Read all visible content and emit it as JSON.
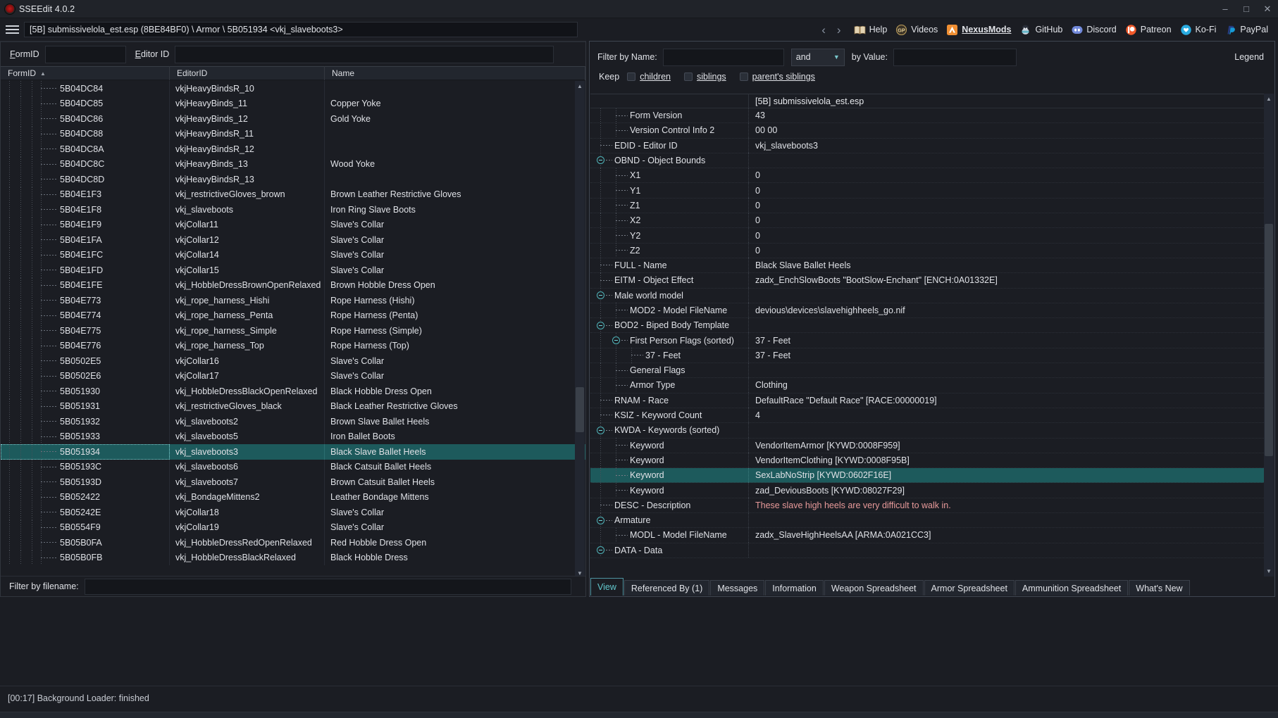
{
  "window": {
    "title": "SSEEdit 4.0.2",
    "app_icon": "sseedit-icon",
    "minimize": "–",
    "maximize": "□",
    "close": "✕"
  },
  "navbar": {
    "menu_icon": "hamburger-icon",
    "path": "[5B] submissivelola_est.esp (8BE84BF0) \\ Armor \\ 5B051934 <vkj_slaveboots3>",
    "back": "‹",
    "forward": "›",
    "links": [
      {
        "label": "Help",
        "icon": "book-icon",
        "active": false
      },
      {
        "label": "Videos",
        "icon": "gamerpoets-icon",
        "active": false
      },
      {
        "label": "NexusMods",
        "icon": "nexusmods-icon",
        "active": true
      },
      {
        "label": "GitHub",
        "icon": "github-icon",
        "active": false
      },
      {
        "label": "Discord",
        "icon": "discord-icon",
        "active": false
      },
      {
        "label": "Patreon",
        "icon": "patreon-icon",
        "active": false
      },
      {
        "label": "Ko-Fi",
        "icon": "kofi-icon",
        "active": false
      },
      {
        "label": "PayPal",
        "icon": "paypal-icon",
        "active": false
      }
    ]
  },
  "left_pane": {
    "filter": {
      "formid_label": "FormID",
      "formid_value": "",
      "editorid_label": "Editor ID",
      "editorid_value": ""
    },
    "columns": [
      "FormID",
      "EditorID",
      "Name"
    ],
    "sort_column": "FormID",
    "sort_direction": "asc",
    "rows": [
      {
        "formid": "5B04DC84",
        "editorid": "vkjHeavyBindsR_10",
        "name": ""
      },
      {
        "formid": "5B04DC85",
        "editorid": "vkjHeavyBinds_11",
        "name": "Copper Yoke"
      },
      {
        "formid": "5B04DC86",
        "editorid": "vkjHeavyBinds_12",
        "name": "Gold Yoke"
      },
      {
        "formid": "5B04DC88",
        "editorid": "vkjHeavyBindsR_11",
        "name": ""
      },
      {
        "formid": "5B04DC8A",
        "editorid": "vkjHeavyBindsR_12",
        "name": ""
      },
      {
        "formid": "5B04DC8C",
        "editorid": "vkjHeavyBinds_13",
        "name": "Wood Yoke"
      },
      {
        "formid": "5B04DC8D",
        "editorid": "vkjHeavyBindsR_13",
        "name": ""
      },
      {
        "formid": "5B04E1F3",
        "editorid": "vkj_restrictiveGloves_brown",
        "name": "Brown Leather Restrictive Gloves"
      },
      {
        "formid": "5B04E1F8",
        "editorid": "vkj_slaveboots",
        "name": "Iron Ring Slave Boots"
      },
      {
        "formid": "5B04E1F9",
        "editorid": "vkjCollar11",
        "name": "Slave's Collar"
      },
      {
        "formid": "5B04E1FA",
        "editorid": "vkjCollar12",
        "name": "Slave's Collar"
      },
      {
        "formid": "5B04E1FC",
        "editorid": "vkjCollar14",
        "name": "Slave's Collar"
      },
      {
        "formid": "5B04E1FD",
        "editorid": "vkjCollar15",
        "name": "Slave's Collar"
      },
      {
        "formid": "5B04E1FE",
        "editorid": "vkj_HobbleDressBrownOpenRelaxed",
        "name": "Brown Hobble Dress Open"
      },
      {
        "formid": "5B04E773",
        "editorid": "vkj_rope_harness_Hishi",
        "name": "Rope Harness (Hishi)"
      },
      {
        "formid": "5B04E774",
        "editorid": "vkj_rope_harness_Penta",
        "name": "Rope Harness (Penta)"
      },
      {
        "formid": "5B04E775",
        "editorid": "vkj_rope_harness_Simple",
        "name": "Rope Harness (Simple)"
      },
      {
        "formid": "5B04E776",
        "editorid": "vkj_rope_harness_Top",
        "name": "Rope Harness (Top)"
      },
      {
        "formid": "5B0502E5",
        "editorid": "vkjCollar16",
        "name": "Slave's Collar"
      },
      {
        "formid": "5B0502E6",
        "editorid": "vkjCollar17",
        "name": "Slave's Collar"
      },
      {
        "formid": "5B051930",
        "editorid": "vkj_HobbleDressBlackOpenRelaxed",
        "name": "Black Hobble Dress Open"
      },
      {
        "formid": "5B051931",
        "editorid": "vkj_restrictiveGloves_black",
        "name": "Black Leather Restrictive Gloves"
      },
      {
        "formid": "5B051932",
        "editorid": "vkj_slaveboots2",
        "name": "Brown Slave Ballet Heels"
      },
      {
        "formid": "5B051933",
        "editorid": "vkj_slaveboots5",
        "name": "Iron Ballet Boots"
      },
      {
        "formid": "5B051934",
        "editorid": "vkj_slaveboots3",
        "name": "Black Slave Ballet Heels",
        "selected": true
      },
      {
        "formid": "5B05193C",
        "editorid": "vkj_slaveboots6",
        "name": "Black Catsuit Ballet Heels"
      },
      {
        "formid": "5B05193D",
        "editorid": "vkj_slaveboots7",
        "name": "Brown Catsuit Ballet Heels"
      },
      {
        "formid": "5B052422",
        "editorid": "vkj_BondageMittens2",
        "name": "Leather Bondage Mittens"
      },
      {
        "formid": "5B05242E",
        "editorid": "vkjCollar18",
        "name": "Slave's Collar"
      },
      {
        "formid": "5B0554F9",
        "editorid": "vkjCollar19",
        "name": "Slave's Collar"
      },
      {
        "formid": "5B05B0FA",
        "editorid": "vkj_HobbleDressRedOpenRelaxed",
        "name": "Red Hobble Dress Open"
      },
      {
        "formid": "5B05B0FB",
        "editorid": "vkj_HobbleDressBlackRelaxed",
        "name": "Black Hobble Dress"
      }
    ],
    "scroll_up_icon": "chevron-up-icon",
    "scroll_down_icon": "chevron-down-icon",
    "bottom_filter_label": "Filter by filename:",
    "bottom_filter_value": ""
  },
  "right_pane": {
    "filter": {
      "name_label": "Filter by Name:",
      "name_value": "",
      "operator": "and",
      "operator_chevron": "chevron-down-icon",
      "value_label": "by Value:",
      "value_value": "",
      "legend": "Legend",
      "keep_label": "Keep",
      "keep_options": [
        {
          "label": "children",
          "checked": false
        },
        {
          "label": "siblings",
          "checked": false
        },
        {
          "label": "parent's siblings",
          "checked": false
        }
      ]
    },
    "column_header": "[5B] submissivelola_est.esp",
    "rows": [
      {
        "key": "Form Version",
        "value": "43",
        "indent": 2,
        "expander": false
      },
      {
        "key": "Version Control Info 2",
        "value": "00 00",
        "indent": 2,
        "expander": false
      },
      {
        "key": "EDID - Editor ID",
        "value": "vkj_slaveboots3",
        "indent": 1,
        "expander": false
      },
      {
        "key": "OBND - Object Bounds",
        "value": "",
        "indent": 1,
        "expander": true
      },
      {
        "key": "X1",
        "value": "0",
        "indent": 2,
        "expander": false
      },
      {
        "key": "Y1",
        "value": "0",
        "indent": 2,
        "expander": false
      },
      {
        "key": "Z1",
        "value": "0",
        "indent": 2,
        "expander": false
      },
      {
        "key": "X2",
        "value": "0",
        "indent": 2,
        "expander": false
      },
      {
        "key": "Y2",
        "value": "0",
        "indent": 2,
        "expander": false
      },
      {
        "key": "Z2",
        "value": "0",
        "indent": 2,
        "expander": false
      },
      {
        "key": "FULL - Name",
        "value": "Black Slave Ballet Heels",
        "indent": 1,
        "expander": false
      },
      {
        "key": "EITM - Object Effect",
        "value": "zadx_EnchSlowBoots \"BootSlow-Enchant\" [ENCH:0A01332E]",
        "indent": 1,
        "expander": false
      },
      {
        "key": "Male world model",
        "value": "",
        "indent": 1,
        "expander": true
      },
      {
        "key": "MOD2 - Model FileName",
        "value": "devious\\devices\\slavehighheels_go.nif",
        "indent": 2,
        "expander": false
      },
      {
        "key": "BOD2 - Biped Body Template",
        "value": "",
        "indent": 1,
        "expander": true
      },
      {
        "key": "First Person Flags (sorted)",
        "value": "37 - Feet",
        "indent": 2,
        "expander": true
      },
      {
        "key": "37 - Feet",
        "value": "37 - Feet",
        "indent": 3,
        "expander": false
      },
      {
        "key": "General Flags",
        "value": "",
        "indent": 2,
        "expander": false
      },
      {
        "key": "Armor Type",
        "value": "Clothing",
        "indent": 2,
        "expander": false
      },
      {
        "key": "RNAM - Race",
        "value": "DefaultRace \"Default Race\" [RACE:00000019]",
        "indent": 1,
        "expander": false
      },
      {
        "key": "KSIZ - Keyword Count",
        "value": "4",
        "indent": 1,
        "expander": false
      },
      {
        "key": "KWDA - Keywords (sorted)",
        "value": "",
        "indent": 1,
        "expander": true
      },
      {
        "key": "Keyword",
        "value": "VendorItemArmor [KYWD:0008F959]",
        "indent": 2,
        "expander": false
      },
      {
        "key": "Keyword",
        "value": "VendorItemClothing [KYWD:0008F95B]",
        "indent": 2,
        "expander": false
      },
      {
        "key": "Keyword",
        "value": "SexLabNoStrip [KYWD:0602F16E]",
        "indent": 2,
        "expander": false,
        "selected": true
      },
      {
        "key": "Keyword",
        "value": "zad_DeviousBoots [KYWD:08027F29]",
        "indent": 2,
        "expander": false
      },
      {
        "key": "DESC - Description",
        "value": "These slave high heels are very difficult to walk in.",
        "indent": 1,
        "expander": false,
        "value_color": "desc"
      },
      {
        "key": "Armature",
        "value": "",
        "indent": 1,
        "expander": true
      },
      {
        "key": "MODL - Model FileName",
        "value": "zadx_SlaveHighHeelsAA [ARMA:0A021CC3]",
        "indent": 2,
        "expander": false
      },
      {
        "key": "DATA - Data",
        "value": "",
        "indent": 1,
        "expander": true
      }
    ],
    "tabs": [
      {
        "label": "View",
        "active": true
      },
      {
        "label": "Referenced By (1)",
        "active": false
      },
      {
        "label": "Messages",
        "active": false
      },
      {
        "label": "Information",
        "active": false
      },
      {
        "label": "Weapon Spreadsheet",
        "active": false
      },
      {
        "label": "Armor Spreadsheet",
        "active": false
      },
      {
        "label": "Ammunition Spreadsheet",
        "active": false
      },
      {
        "label": "What's New",
        "active": false
      }
    ]
  },
  "statusbar": {
    "message": "[00:17] Background Loader: finished"
  },
  "colors": {
    "selection": "#1d5a5c",
    "accent": "#63c9ce",
    "background": "#1b1d23",
    "description_text": "#e89a9a"
  }
}
